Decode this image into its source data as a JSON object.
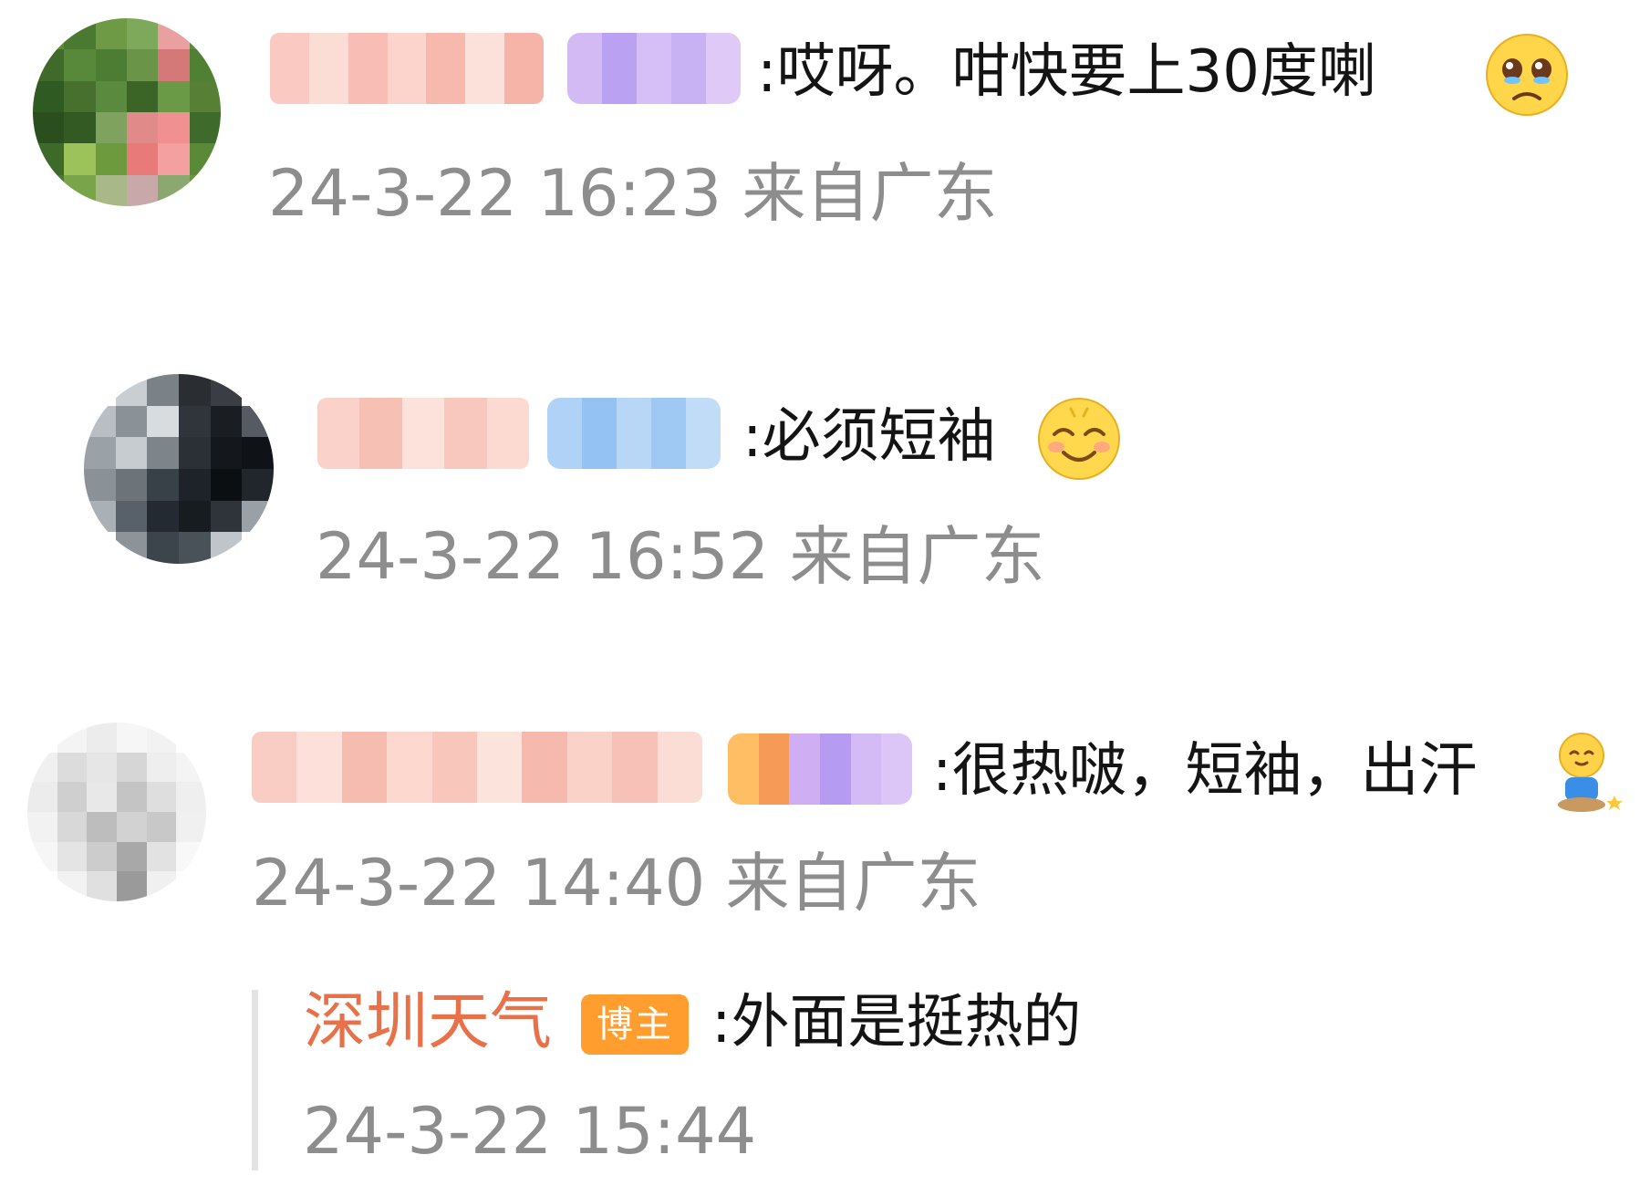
{
  "comments": [
    {
      "text": ":哎呀。咁快要上30度喇",
      "emoji": "crying-face-emoji",
      "time": "24-3-22 16:23",
      "source": "来自广东"
    },
    {
      "text": ":必须短袖",
      "emoji": "smiling-face-emoji",
      "time": "24-3-22 16:52",
      "source": "来自广东"
    },
    {
      "text": ":很热啵，短袖，出汗",
      "emoji": "sitting-person-emoji",
      "time": "24-3-22 14:40",
      "source": "来自广东",
      "reply": {
        "author": "深圳天气",
        "badge": "博主",
        "text": ":外面是挺热的",
        "time": "24-3-22 15:44"
      }
    }
  ],
  "colors": {
    "blogger_name": "#e8714a",
    "blogger_badge": "#ff9d2e",
    "meta_text": "#8d8d8d"
  }
}
